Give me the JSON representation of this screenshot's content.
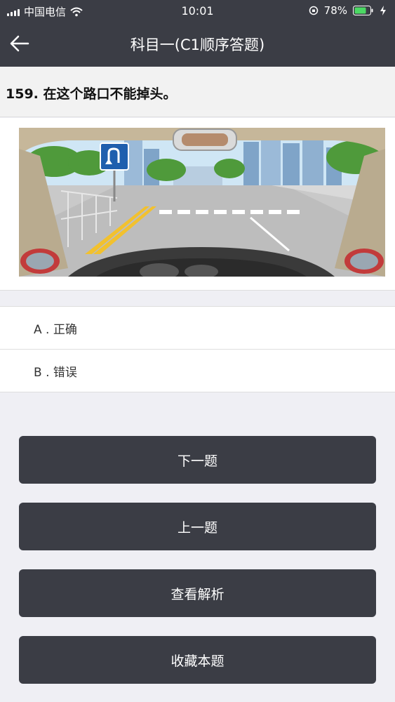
{
  "status": {
    "carrier": "中国电信",
    "time": "10:01",
    "battery": "78%"
  },
  "nav": {
    "title": "科目一(C1顺序答题)",
    "back_icon": "arrow-left-icon"
  },
  "question": {
    "text": "159. 在这个路口不能掉头。"
  },
  "options": [
    {
      "label": "A . 正确"
    },
    {
      "label": "B . 错误"
    }
  ],
  "buttons": {
    "next": "下一题",
    "prev": "上一题",
    "analysis": "查看解析",
    "favorite": "收藏本题"
  },
  "colors": {
    "bar": "#3b3d45",
    "background": "#efeff4",
    "sign": "#1f5fae"
  }
}
